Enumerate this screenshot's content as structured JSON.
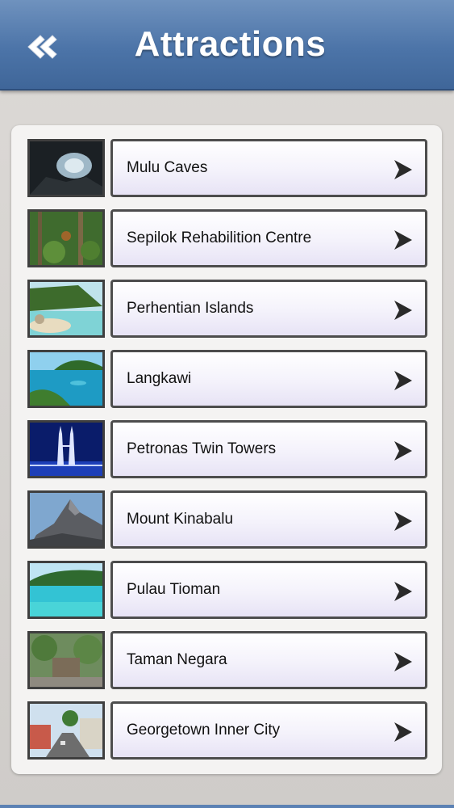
{
  "header": {
    "title": "Attractions",
    "back_icon": "double-chevron-left-icon"
  },
  "attractions": [
    {
      "label": "Mulu Caves",
      "thumb": "cave"
    },
    {
      "label": "Sepilok Rehabilition Centre",
      "thumb": "jungle"
    },
    {
      "label": "Perhentian Islands",
      "thumb": "beach"
    },
    {
      "label": "Langkawi",
      "thumb": "bay"
    },
    {
      "label": "Petronas Twin Towers",
      "thumb": "towers"
    },
    {
      "label": "Mount Kinabalu",
      "thumb": "mountain"
    },
    {
      "label": "Pulau Tioman",
      "thumb": "sea"
    },
    {
      "label": "Taman Negara",
      "thumb": "forest"
    },
    {
      "label": "Georgetown Inner City",
      "thumb": "street"
    }
  ],
  "colors": {
    "header": "#4c74a8",
    "panel": "#f4f3f2",
    "item_border": "#4d4d4d"
  }
}
